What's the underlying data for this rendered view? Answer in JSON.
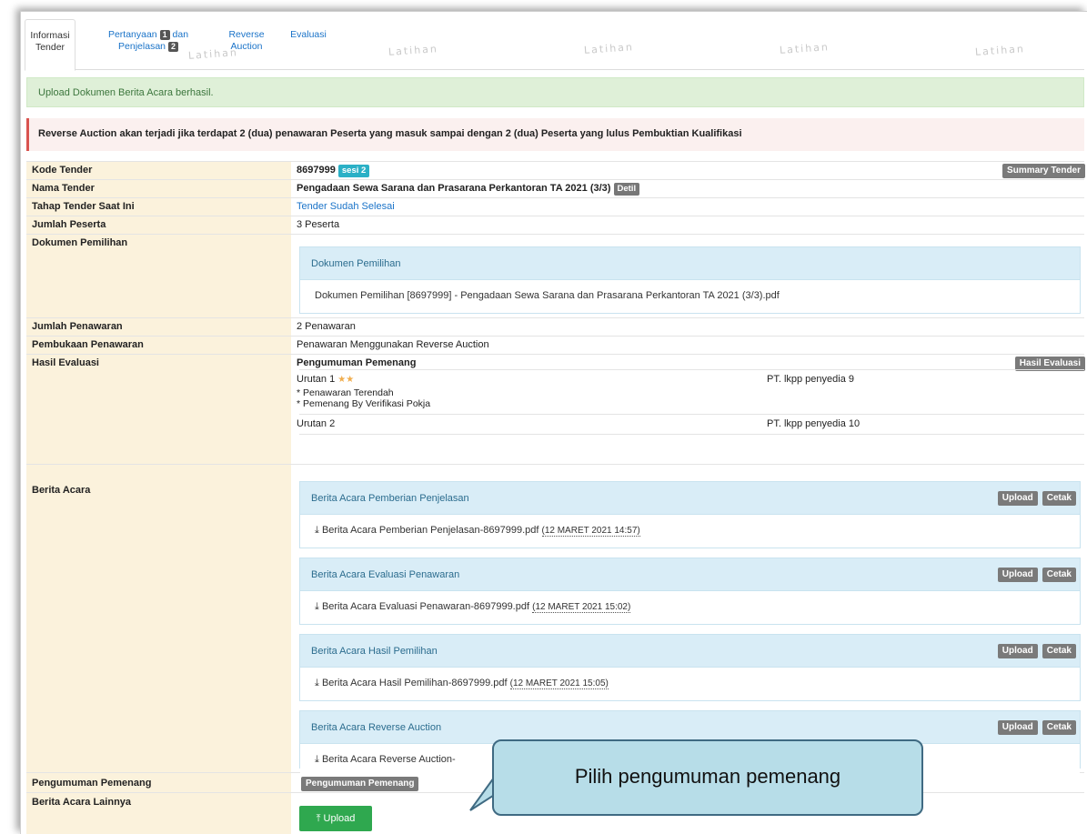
{
  "tabs": [
    {
      "line1": "Informasi",
      "line2": "Tender"
    },
    {
      "line1a": "Pertanyaan",
      "num1": "1",
      "line1b": "dan",
      "line2a": "Penjelasan",
      "num2": "2"
    },
    {
      "line1": "Reverse",
      "line2": "Auction"
    },
    {
      "line1": "Evaluasi"
    }
  ],
  "watermark": "Latihan",
  "alerts": {
    "success": "Upload Dokumen Berita Acara berhasil.",
    "danger": "Reverse Auction akan terjadi jika terdapat 2 (dua) penawaran Peserta yang masuk sampai dengan 2 (dua) Peserta yang lulus Pembuktian Kualifikasi"
  },
  "rows": {
    "kode": {
      "label": "Kode Tender",
      "value": "8697999",
      "badge": "sesi 2",
      "button": "Summary Tender"
    },
    "nama": {
      "label": "Nama Tender",
      "value": "Pengadaan Sewa Sarana dan Prasarana Perkantoran TA 2021 (3/3)",
      "badge": "Detil"
    },
    "tahap": {
      "label": "Tahap Tender Saat Ini",
      "value": "Tender Sudah Selesai"
    },
    "peserta": {
      "label": "Jumlah Peserta",
      "value": "3 Peserta"
    },
    "dokumen": {
      "label": "Dokumen Pemilihan",
      "panel_title": "Dokumen Pemilihan",
      "file": "Dokumen Pemilihan [8697999] - Pengadaan Sewa Sarana dan Prasarana Perkantoran TA 2021 (3/3).pdf"
    },
    "penawaran": {
      "label": "Jumlah Penawaran",
      "value": "2 Penawaran"
    },
    "pembukaan": {
      "label": "Pembukaan Penawaran",
      "value": "Penawaran Menggunakan Reverse Auction"
    },
    "hasil": {
      "label": "Hasil Evaluasi",
      "title": "Pengumuman Pemenang",
      "button": "Hasil Evaluasi",
      "urutan1": "Urutan 1",
      "note1": "* Penawaran Terendah",
      "note2": "* Pemenang By Verifikasi Pokja",
      "peserta1": "PT. lkpp penyedia 9",
      "urutan2": "Urutan 2",
      "peserta2": "PT. lkpp penyedia 10"
    },
    "berita": {
      "label": "Berita Acara",
      "upload": "Upload",
      "cetak": "Cetak",
      "panels": [
        {
          "title": "Berita Acara Pemberian Penjelasan",
          "file": "Berita Acara Pemberian Penjelasan-8697999.pdf",
          "date": "(12 MARET 2021 14:57)"
        },
        {
          "title": "Berita Acara Evaluasi Penawaran",
          "file": "Berita Acara Evaluasi Penawaran-8697999.pdf",
          "date": "(12 MARET 2021 15:02)"
        },
        {
          "title": "Berita Acara Hasil Pemilihan",
          "file": "Berita Acara Hasil Pemilihan-8697999.pdf",
          "date": "(12 MARET 2021 15:05)"
        },
        {
          "title": "Berita Acara Reverse Auction",
          "file": "Berita Acara Reverse Auction-",
          "date": ""
        }
      ]
    },
    "pengumuman": {
      "label": "Pengumuman Pemenang",
      "button": "Pengumuman Pemenang"
    },
    "lainnya": {
      "label": "Berita Acara Lainnya",
      "button": "Upload"
    }
  },
  "callout": {
    "text": "Pilih pengumuman pemenang"
  }
}
